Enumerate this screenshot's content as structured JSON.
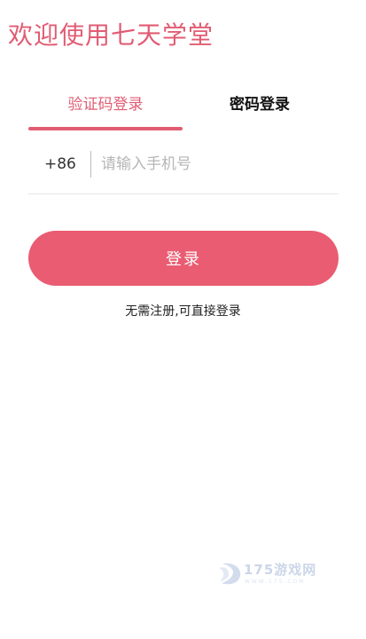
{
  "page": {
    "title": "欢迎使用七天学堂"
  },
  "tabs": [
    {
      "label": "验证码登录",
      "active": true
    },
    {
      "label": "密码登录",
      "active": false
    }
  ],
  "phone": {
    "country_code": "+86",
    "placeholder": "请输入手机号",
    "value": ""
  },
  "actions": {
    "login_label": "登录",
    "hint": "无需注册,可直接登录"
  },
  "watermark": {
    "text": "175游戏网",
    "subtext": "WWW.175.COM"
  },
  "colors": {
    "accent": "#e95c72",
    "title": "#e15c73",
    "text_dark": "#111111",
    "placeholder": "#b6b6b6",
    "divider": "#e6e6e6"
  },
  "icons": {
    "watermark_logo": "watermark-logo-icon"
  }
}
